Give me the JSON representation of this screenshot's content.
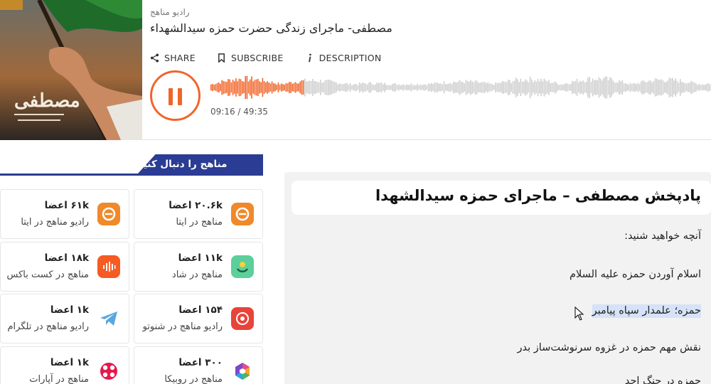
{
  "player": {
    "channel": "رادیو مناهج",
    "episode_title": "مصطفی- ماجرای زندگی حضرت حمزه سیدالشهداء",
    "actions": [
      {
        "label": "SHARE",
        "icon": "share-icon"
      },
      {
        "label": "SUBSCRIBE",
        "icon": "bookmark-icon"
      },
      {
        "label": "DESCRIPTION",
        "icon": "info-icon"
      }
    ],
    "state": "playing",
    "time": "09:16 / 49:35",
    "progress": 0.187,
    "accent_color": "#f0652a",
    "wave_inactive_color": "#cfcfcf"
  },
  "follow": {
    "heading": "مناهج را دنبال کنید",
    "accent_color": "#2a3c93",
    "cards": [
      {
        "count": "۲۰.۶k اعضا",
        "platform": "مناهج در ایتا",
        "icon": "eitaa-icon"
      },
      {
        "count": "۶۱k اعضا",
        "platform": "رادیو مناهج در ایتا",
        "icon": "eitaa-icon"
      },
      {
        "count": "۱۱k اعضا",
        "platform": "مناهج در شاد",
        "icon": "shad-icon"
      },
      {
        "count": "۱۸k اعضا",
        "platform": "مناهج در کست باکس",
        "icon": "castbox-icon"
      },
      {
        "count": "۱۵۴ اعضا",
        "platform": "رادیو مناهج در شنوتو",
        "icon": "shenoto-icon"
      },
      {
        "count": "۱k اعضا",
        "platform": "رادیو مناهج در تلگرام",
        "icon": "telegram-icon"
      },
      {
        "count": "۳۰۰ اعضا",
        "platform": "مناهج در روبیکا",
        "icon": "rubika-icon"
      },
      {
        "count": "۱k اعضا",
        "platform": "مناهج در آپارات",
        "icon": "aparat-icon"
      }
    ]
  },
  "article": {
    "title": "پادپخش مصطفی – ماجرای حمزه سیدالشهدا",
    "lines": [
      "آنچه خواهید شنید:",
      "اسلام آوردن حمزه علیه السلام",
      "حمزه؛ علمدار سپاه پیامبر",
      "نقش مهم حمزه در غزوه سرنوشت‌ساز بدر",
      "حمزه در جنگ احد"
    ],
    "selected_line": 2
  }
}
